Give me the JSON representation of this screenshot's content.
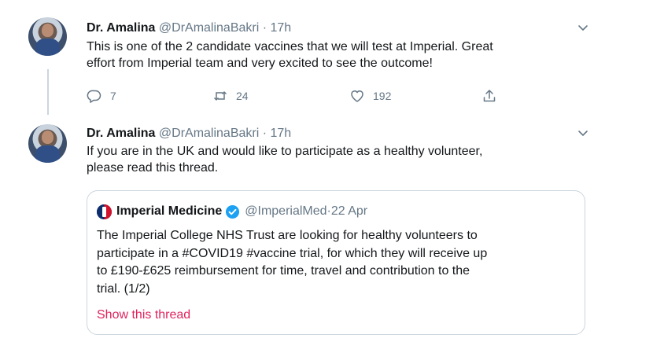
{
  "tweets": [
    {
      "name": "Dr. Amalina",
      "handle": "@DrAmalinaBakri",
      "sep": " · ",
      "time": "17h",
      "lines": [
        "This is one of the 2 candidate vaccines that we will test at Imperial. Great",
        "effort from Imperial team and very excited to see the outcome!"
      ],
      "replies": "7",
      "retweets": "24",
      "likes": "192"
    },
    {
      "name": "Dr. Amalina",
      "handle": "@DrAmalinaBakri",
      "sep": " · ",
      "time": "17h",
      "lines": [
        "If you are in the UK and would like to participate as a healthy volunteer,",
        "please read this thread."
      ]
    }
  ],
  "quote": {
    "name": "Imperial Medicine",
    "handle": "@ImperialMed",
    "sep": " · ",
    "date": "22 Apr",
    "lines": [
      "The Imperial College NHS Trust are looking for healthy volunteers to",
      "participate in a #COVID19 #vaccine trial, for which they will receive up",
      "to £190-£625 reimbursement for time, travel and contribution to the",
      "trial. (1/2)"
    ],
    "link": "Show this thread"
  },
  "icons": {
    "reply": "reply-icon",
    "retweet": "retweet-icon",
    "like": "heart-icon",
    "share": "share-icon",
    "caret": "chevron-down-icon",
    "verified": "verified-badge-icon",
    "logo": "imperial-logo"
  },
  "colors": {
    "text": "#14171a",
    "muted": "#657786",
    "link": "#e0245e",
    "border": "#ccd6dd",
    "verified": "#1da1f2"
  }
}
